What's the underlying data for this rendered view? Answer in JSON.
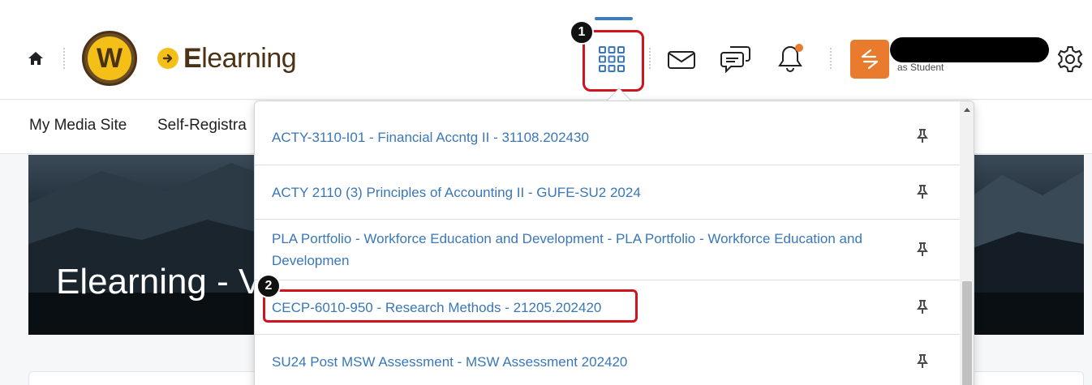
{
  "header": {
    "logo_letter": "W",
    "brand_prefix": "E",
    "brand_rest": "learning",
    "role_label": "as Student",
    "notification_dot_color": "#e87b2d"
  },
  "nav": {
    "items": [
      "My Media Site",
      "Self-Registra"
    ]
  },
  "banner": {
    "title": "Elearning - V"
  },
  "course_selector": {
    "courses": [
      {
        "name": "ACTY-3110-I01 - Financial Accntg II - 31108.202430"
      },
      {
        "name": "ACTY 2110 (3) Principles of Accounting II - GUFE-SU2 2024"
      },
      {
        "name": "PLA Portfolio - Workforce Education and Development - PLA Portfolio - Workforce Education and Developmen"
      },
      {
        "name": "CECP-6010-950 - Research Methods - 21205.202420"
      },
      {
        "name": "SU24 Post MSW Assessment - MSW Assessment 202420"
      }
    ]
  },
  "annotations": {
    "step1": "1",
    "step2": "2",
    "highlight_color": "#d0131d"
  },
  "colors": {
    "link": "#3a77b8",
    "brand_brown": "#4b3215",
    "brand_gold": "#f4c017",
    "role_tile": "#e87b2d"
  }
}
